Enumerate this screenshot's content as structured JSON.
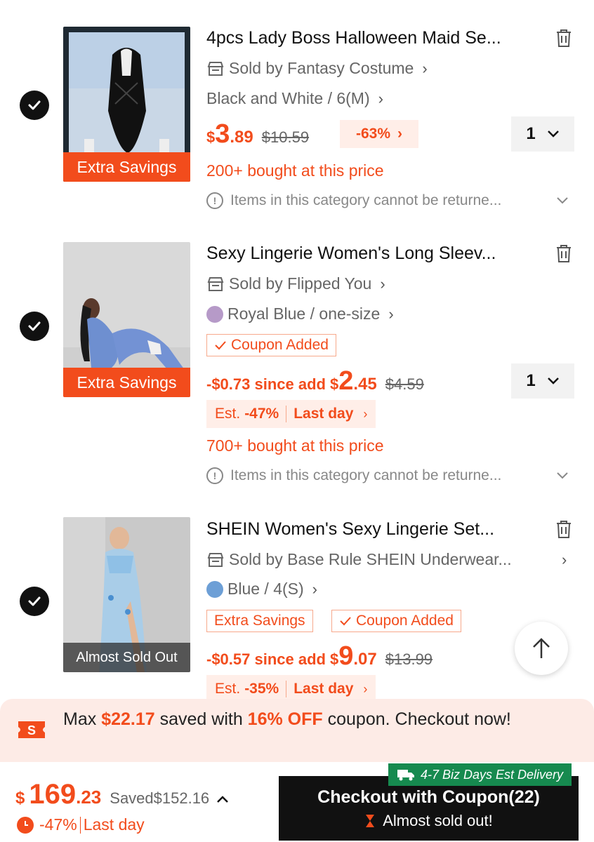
{
  "items": [
    {
      "title": "4pcs Lady Boss Halloween Maid Se...",
      "seller": "Sold by Fantasy Costume",
      "variant": "Black and White / 6(M)",
      "price_currency": "$",
      "price_int": "3",
      "price_dec": ".89",
      "original_price": "$10.59",
      "discount_badge": "-63%",
      "quantity": "1",
      "image_badge": "Extra Savings",
      "bought": "200+ bought at this price",
      "notice": "Items in this category cannot be returne..."
    },
    {
      "title": "Sexy Lingerie Women's Long Sleev...",
      "seller": "Sold by Flipped You",
      "variant": "Royal Blue / one-size",
      "swatch_color": "#b69ac8",
      "coupon_tag": "Coupon Added",
      "since_add": "-$0.73 since add",
      "price_currency": "$",
      "price_int": "2",
      "price_dec": ".45",
      "original_price": "$4.59",
      "quantity": "1",
      "est_label": "Est.",
      "est_pct": "-47%",
      "last_day": "Last day",
      "image_badge": "Extra Savings",
      "bought": "700+ bought at this price",
      "notice": "Items in this category cannot be returne..."
    },
    {
      "title": "SHEIN Women's Sexy Lingerie Set...",
      "seller": "Sold by Base Rule SHEIN Underwear...",
      "variant": "Blue / 4(S)",
      "swatch_color": "#6d9fd6",
      "tag_extra": "Extra Savings",
      "coupon_tag": "Coupon Added",
      "since_add": "-$0.57 since add",
      "price_currency": "$",
      "price_int": "9",
      "price_dec": ".07",
      "original_price": "$13.99",
      "est_label": "Est.",
      "est_pct": "-35%",
      "last_day": "Last day",
      "image_badge": "Almost Sold Out"
    }
  ],
  "coupon_bar": {
    "prefix": "Max ",
    "amount": "$22.17",
    "middle": " saved with ",
    "off": "16% OFF",
    "suffix": " coupon. Checkout now!",
    "icon_letter": "S"
  },
  "footer": {
    "currency": "$",
    "total_int": "169",
    "total_dec": ".23",
    "saved": "Saved$152.16",
    "discount": "-47%",
    "last_day": "Last day",
    "checkout_label": "Checkout with Coupon(22)",
    "checkout_sub": "Almost sold out!",
    "delivery": "4-7 Biz Days Est Delivery"
  },
  "colors": {
    "accent": "#f24c1c",
    "delivery_green": "#168a4f",
    "coupon_bg": "#fdebe6"
  }
}
